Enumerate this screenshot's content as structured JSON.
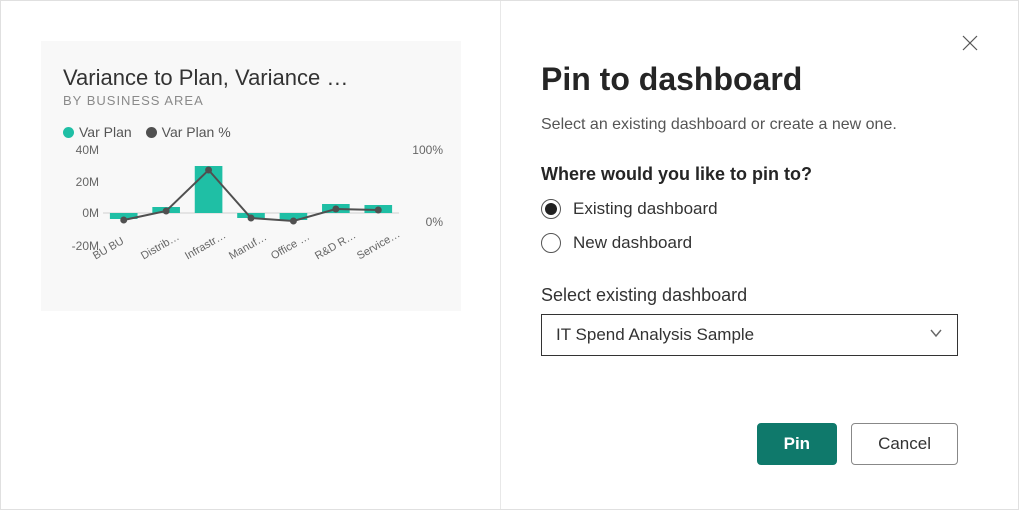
{
  "dialog": {
    "title": "Pin to dashboard",
    "description": "Select an existing dashboard or create a new one.",
    "question": "Where would you like to pin to?",
    "option_existing": "Existing dashboard",
    "option_new": "New dashboard",
    "select_label": "Select existing dashboard",
    "selected_dashboard": "IT Spend Analysis Sample",
    "pin_button": "Pin",
    "cancel_button": "Cancel"
  },
  "visual": {
    "title": "Variance to Plan, Variance …",
    "subtitle": "BY BUSINESS AREA",
    "legend_varplan": "Var Plan",
    "legend_varplan_pct": "Var Plan %",
    "y_40m": "40M",
    "y_20m": "20M",
    "y_0m": "0M",
    "y_neg20m": "-20M",
    "y2_100pct": "100%",
    "y2_0pct": "0%",
    "x_bu": "BU BU",
    "x_distrib": "Distrib…",
    "x_infra": "Infrastr…",
    "x_manuf": "Manuf…",
    "x_office": "Office …",
    "x_rd": "R&D R…",
    "x_service": "Service…"
  },
  "colors": {
    "teal": "#1fbfa5",
    "dark_gray": "#505050",
    "primary_button": "#0f796b"
  },
  "chart_data": {
    "type": "bar",
    "title": "Variance to Plan, Variance …",
    "subtitle": "BY BUSINESS AREA",
    "categories": [
      "BU BU",
      "Distrib…",
      "Infrastr…",
      "Manuf…",
      "Office …",
      "R&D R…",
      "Service…"
    ],
    "series": [
      {
        "name": "Var Plan",
        "type": "bar",
        "axis": "left",
        "color": "#1fbfa5",
        "values": [
          -4,
          4,
          30,
          -3,
          -4,
          6,
          5
        ]
      },
      {
        "name": "Var Plan %",
        "type": "line",
        "axis": "right",
        "color": "#505050",
        "values": [
          -7,
          2,
          30,
          -5,
          -8,
          5,
          3
        ]
      }
    ],
    "ylabel_left": "M",
    "ylim_left": [
      -20,
      40
    ],
    "y_ticks_left": [
      "40M",
      "20M",
      "0M",
      "-20M"
    ],
    "ylabel_right": "%",
    "ylim_right": [
      -33,
      100
    ],
    "y_ticks_right": [
      "100%",
      "0%"
    ],
    "xlabel": "Business Area"
  }
}
